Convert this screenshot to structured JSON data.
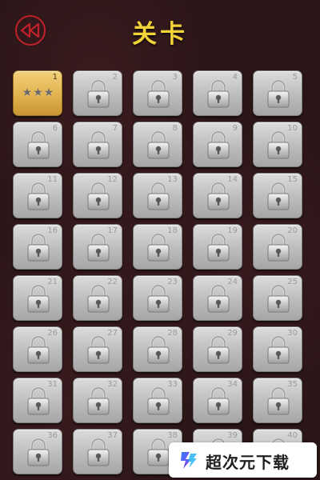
{
  "header": {
    "back_icon": "rewind-icon",
    "title": "关卡"
  },
  "colors": {
    "background": "#2a1517",
    "title": "#f2d43a",
    "back_ring": "#c0202a",
    "locked_tile": "#bcbcbc",
    "unlocked_tile": "#e1b24d"
  },
  "levels": [
    {
      "number": "1",
      "state": "unlocked",
      "stars": "★★★"
    },
    {
      "number": "2",
      "state": "locked"
    },
    {
      "number": "3",
      "state": "locked"
    },
    {
      "number": "4",
      "state": "locked"
    },
    {
      "number": "5",
      "state": "locked"
    },
    {
      "number": "6",
      "state": "locked"
    },
    {
      "number": "7",
      "state": "locked"
    },
    {
      "number": "8",
      "state": "locked"
    },
    {
      "number": "9",
      "state": "locked"
    },
    {
      "number": "10",
      "state": "locked"
    },
    {
      "number": "11",
      "state": "locked"
    },
    {
      "number": "12",
      "state": "locked"
    },
    {
      "number": "13",
      "state": "locked"
    },
    {
      "number": "14",
      "state": "locked"
    },
    {
      "number": "15",
      "state": "locked"
    },
    {
      "number": "16",
      "state": "locked"
    },
    {
      "number": "17",
      "state": "locked"
    },
    {
      "number": "18",
      "state": "locked"
    },
    {
      "number": "19",
      "state": "locked"
    },
    {
      "number": "20",
      "state": "locked"
    },
    {
      "number": "21",
      "state": "locked"
    },
    {
      "number": "22",
      "state": "locked"
    },
    {
      "number": "23",
      "state": "locked"
    },
    {
      "number": "24",
      "state": "locked"
    },
    {
      "number": "25",
      "state": "locked"
    },
    {
      "number": "26",
      "state": "locked"
    },
    {
      "number": "27",
      "state": "locked"
    },
    {
      "number": "28",
      "state": "locked"
    },
    {
      "number": "29",
      "state": "locked"
    },
    {
      "number": "30",
      "state": "locked"
    },
    {
      "number": "31",
      "state": "locked"
    },
    {
      "number": "32",
      "state": "locked"
    },
    {
      "number": "33",
      "state": "locked"
    },
    {
      "number": "34",
      "state": "locked"
    },
    {
      "number": "35",
      "state": "locked"
    },
    {
      "number": "36",
      "state": "locked"
    },
    {
      "number": "37",
      "state": "locked"
    },
    {
      "number": "38",
      "state": "locked"
    },
    {
      "number": "39",
      "state": "locked"
    },
    {
      "number": "40",
      "state": "locked"
    }
  ],
  "watermark": {
    "logo_icon": "chaoci-logo-icon",
    "text": "超次元下载"
  }
}
